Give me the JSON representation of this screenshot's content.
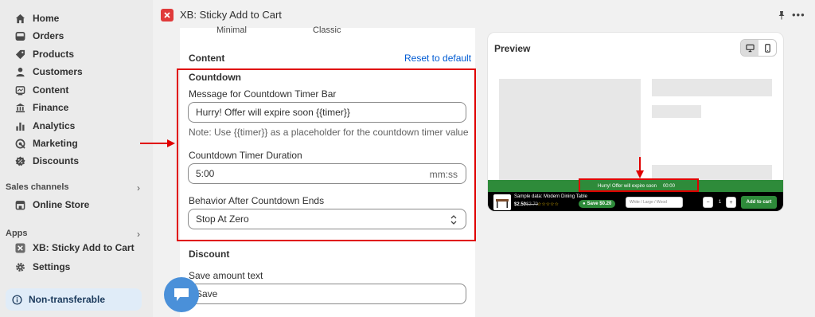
{
  "app": {
    "title": "XB: Sticky Add to Cart",
    "more_label": "•••"
  },
  "sidebar": {
    "items": [
      {
        "label": "Home",
        "icon": "home-icon"
      },
      {
        "label": "Orders",
        "icon": "orders-icon"
      },
      {
        "label": "Products",
        "icon": "tag-icon"
      },
      {
        "label": "Customers",
        "icon": "person-icon"
      },
      {
        "label": "Content",
        "icon": "content-icon"
      },
      {
        "label": "Finance",
        "icon": "bank-icon"
      },
      {
        "label": "Analytics",
        "icon": "bar-chart-icon"
      },
      {
        "label": "Marketing",
        "icon": "target-icon"
      },
      {
        "label": "Discounts",
        "icon": "discount-icon"
      }
    ],
    "sales_channels_label": "Sales channels",
    "online_store_label": "Online Store",
    "apps_label": "Apps",
    "app_item_label": "XB: Sticky Add to Cart",
    "settings_label": "Settings",
    "non_transferable_label": "Non-transferable"
  },
  "settings": {
    "layout_options": [
      "Minimal",
      "Classic"
    ],
    "content_heading": "Content",
    "reset_label": "Reset to default",
    "countdown": {
      "heading": "Countdown",
      "message_label": "Message for Countdown Timer Bar",
      "message_value": "Hurry! Offer will expire soon {{timer}}",
      "note": "Note: Use {{timer}} as a placeholder for the countdown timer value",
      "duration_label": "Countdown Timer Duration",
      "duration_value": "5:00",
      "duration_suffix": "mm:ss",
      "behavior_label": "Behavior After Countdown Ends",
      "behavior_value": "Stop At Zero"
    },
    "discount": {
      "heading": "Discount",
      "save_amount_label": "Save amount text",
      "save_amount_value": "Save"
    }
  },
  "preview": {
    "title": "Preview",
    "countdown_text": "Hurry! Offer will expire soon",
    "countdown_timer": "00:00",
    "product_name": "Sample data: Modern Dining Table",
    "price": "$2.50",
    "compare_price": "$2.70",
    "stars": "☆☆☆☆☆",
    "save_badge": "Save $0.20",
    "variant": "White / Large / Wood",
    "qty_minus": "−",
    "qty_value": "1",
    "qty_plus": "+",
    "add_to_cart_label": "Add to cart"
  },
  "colors": {
    "accent_green": "#2e8b3a",
    "highlight_red": "#e00000",
    "link_blue": "#005bd3"
  }
}
